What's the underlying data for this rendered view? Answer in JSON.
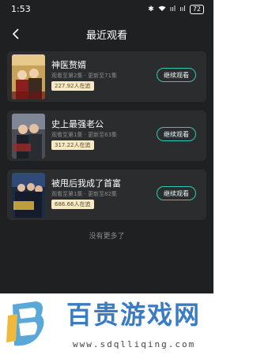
{
  "status": {
    "time": "1:53",
    "signal": "ııl",
    "battery": "72"
  },
  "nav": {
    "title": "最近观看"
  },
  "cards": [
    {
      "title": "神医赘婿",
      "progress": "观看至第2集 · 更新至71集",
      "badge": "227.92人在追",
      "button": "继续观看",
      "poster_label": "神医赘婿"
    },
    {
      "title": "史上最强老公",
      "progress": "观看至第1集 · 更新至63集",
      "badge": "317.22人在追",
      "button": "继续观看",
      "poster_label": "史上最强老公"
    },
    {
      "title": "被甩后我成了首富",
      "progress": "观看至第1集 · 更新至82集",
      "badge": "686.66人在追",
      "button": "继续观看",
      "poster_label": "我成了首富"
    }
  ],
  "footer": {
    "no_more": "没有更多了"
  },
  "watermark": {
    "title": "百贵游戏网",
    "url": "www.sdqlliqing.com"
  }
}
